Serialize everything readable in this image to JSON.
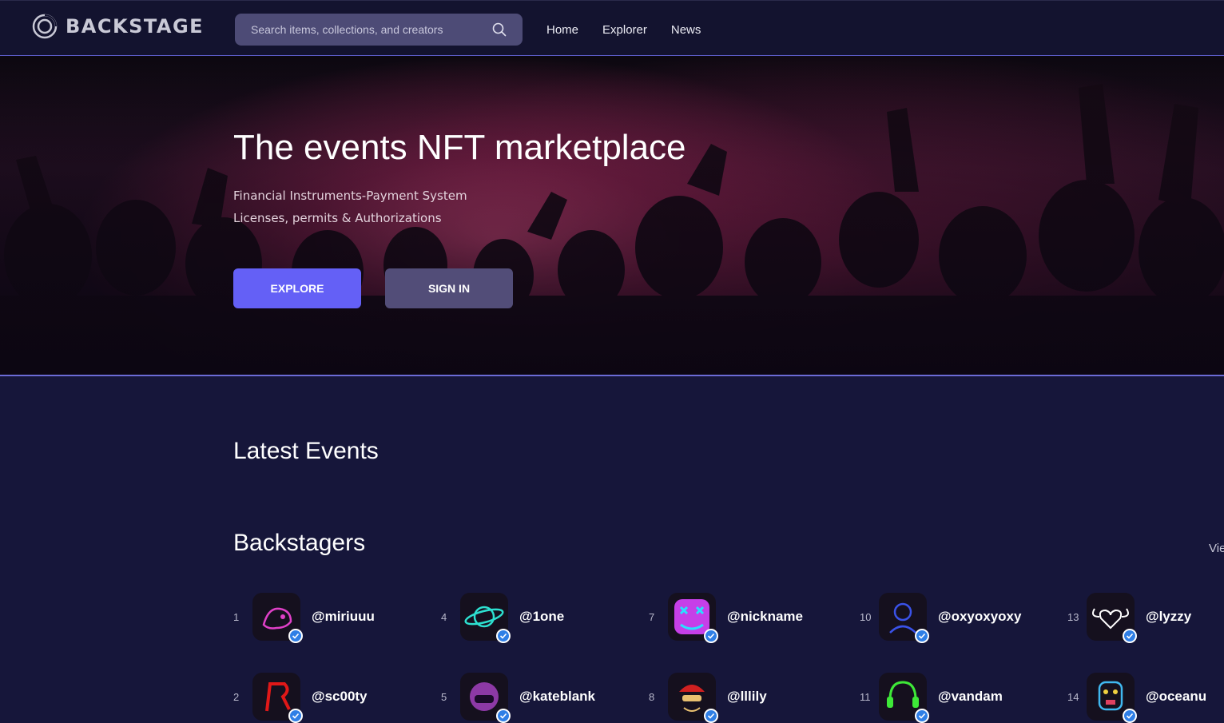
{
  "header": {
    "brand": "BACKSTAGE",
    "search_placeholder": "Search items, collections, and creators",
    "nav": [
      "Home",
      "Explorer",
      "News"
    ]
  },
  "hero": {
    "title": "The events NFT marketplace",
    "subtitle_lines": [
      "Financial Instruments-Payment System",
      "Licenses, permits & Authorizations"
    ],
    "explore_label": "EXPLORE",
    "signin_label": "SIGN IN"
  },
  "latest_events": {
    "title": "Latest Events"
  },
  "backstagers": {
    "title": "Backstagers",
    "view_all": "Vie",
    "creators": [
      {
        "rank": "1",
        "handle": "@miriuuu",
        "avatar_icon": "neon-lion-avatar",
        "color": "#e040c8"
      },
      {
        "rank": "2",
        "handle": "@sc00ty",
        "avatar_icon": "neon-r-letter-avatar",
        "color": "#e01818"
      },
      {
        "rank": "4",
        "handle": "@1one",
        "avatar_icon": "neon-planet-avatar",
        "color": "#2de0d0"
      },
      {
        "rank": "5",
        "handle": "@kateblank",
        "avatar_icon": "neon-astronaut-avatar",
        "color": "#c04ce0"
      },
      {
        "rank": "7",
        "handle": "@nickname",
        "avatar_icon": "neon-x-eyes-face-avatar",
        "color": "#c63fe8"
      },
      {
        "rank": "8",
        "handle": "@lllily",
        "avatar_icon": "neon-cap-face-avatar",
        "color": "#e8c070"
      },
      {
        "rank": "10",
        "handle": "@oxyoxyoxy",
        "avatar_icon": "neon-pilot-avatar",
        "color": "#3a52e8"
      },
      {
        "rank": "11",
        "handle": "@vandam",
        "avatar_icon": "neon-headphones-avatar",
        "color": "#3ee838"
      },
      {
        "rank": "13",
        "handle": "@lyzzy",
        "avatar_icon": "neon-winged-heart-avatar",
        "color": "#f050a0"
      },
      {
        "rank": "14",
        "handle": "@oceanu",
        "avatar_icon": "neon-robot-face-avatar",
        "color": "#40b8f0"
      }
    ]
  },
  "colors": {
    "accent": "#6460f6",
    "background": "#16163a",
    "verified": "#2f7fe6"
  }
}
